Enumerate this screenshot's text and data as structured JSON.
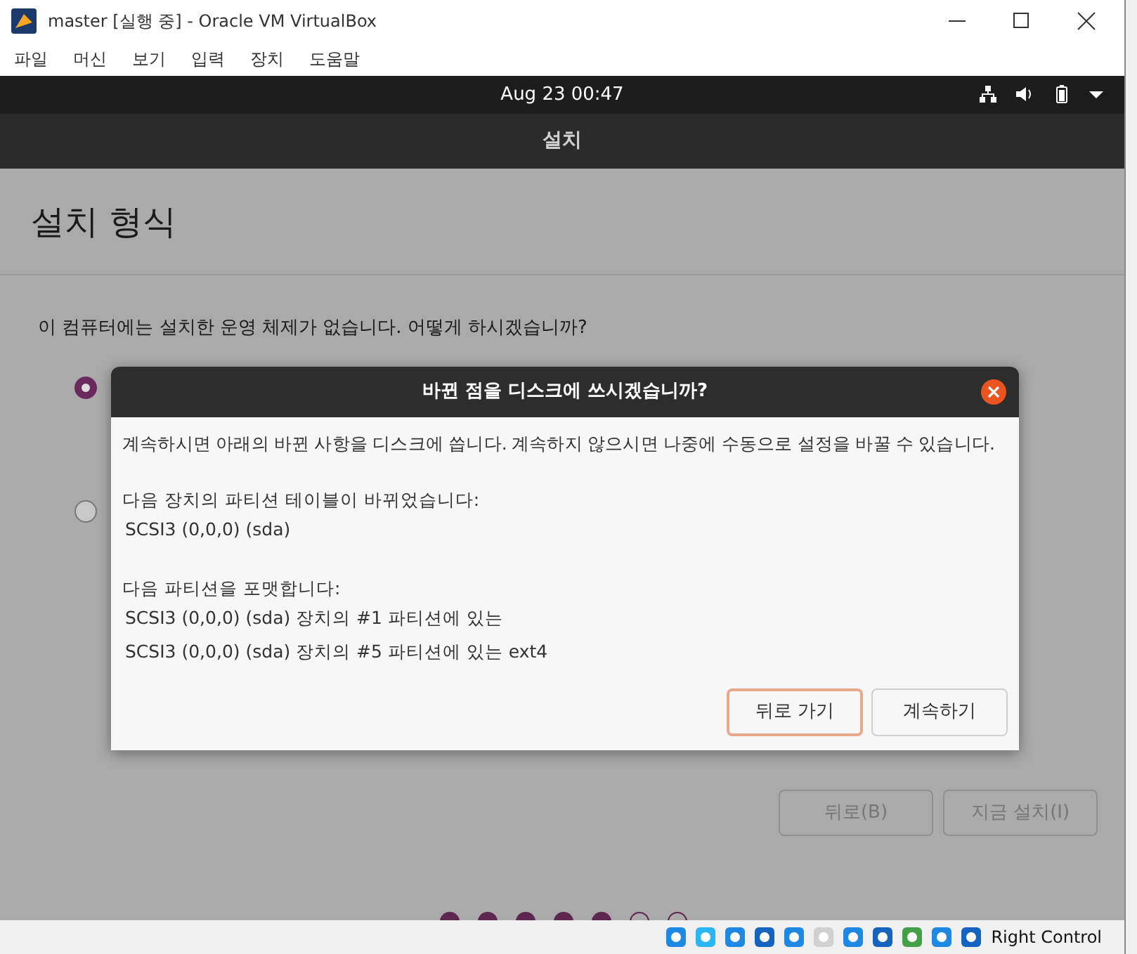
{
  "window": {
    "title": "master [실행 중] - Oracle VM VirtualBox"
  },
  "menu": [
    "파일",
    "머신",
    "보기",
    "입력",
    "장치",
    "도움말"
  ],
  "top_bar": {
    "clock": "Aug 23  00:47"
  },
  "installer": {
    "header": "설치",
    "heading": "설치 형식",
    "question": "이 컴퓨터에는 설치한 운영 체제가 없습니다. 어떻게 하시겠습니까?",
    "options": [
      {
        "selected": true
      },
      {
        "selected": false
      }
    ],
    "buttons": [
      "뒤로(B)",
      "지금 설치(I)"
    ],
    "steps": [
      {
        "done": true
      },
      {
        "done": true
      },
      {
        "done": true
      },
      {
        "done": true
      },
      {
        "done": true
      },
      {
        "done": false
      },
      {
        "done": false
      }
    ]
  },
  "dialog": {
    "title": "바뀐 점을 디스크에 쓰시겠습니까?",
    "intro": "계속하시면 아래의 바뀐 사항을 디스크에 씁니다. 계속하지 않으시면 나중에 수동으로 설정을 바꿀 수 있습니다.",
    "sections": [
      {
        "heading": "다음 장치의 파티션 테이블이 바뀌었습니다:",
        "lines": [
          "SCSI3 (0,0,0) (sda)"
        ]
      },
      {
        "heading": "다음 파티션을 포맷합니다:",
        "lines": [
          "SCSI3 (0,0,0) (sda) 장치의 #1 파티션에 있는",
          "SCSI3 (0,0,0) (sda) 장치의 #5 파티션에 있는 ext4"
        ]
      }
    ],
    "buttons": [
      {
        "label": "뒤로 가기",
        "focused": true
      },
      {
        "label": "계속하기",
        "focused": false
      }
    ]
  },
  "status_bar": {
    "host_key": "Right Control"
  }
}
